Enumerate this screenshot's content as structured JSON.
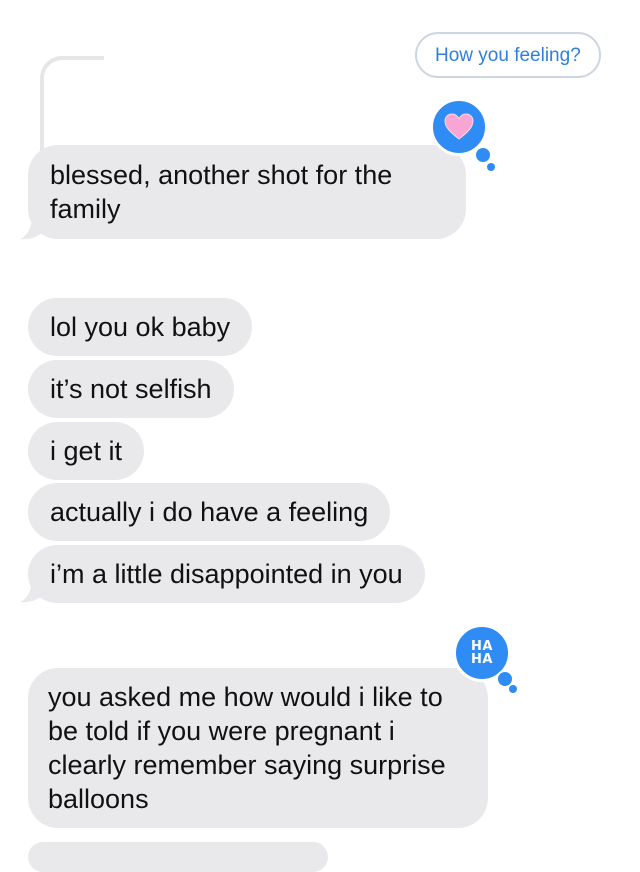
{
  "thread": {
    "quoted_reply": "How you feeling?",
    "messages": [
      {
        "text": "blessed, another shot for the family",
        "tapback": "heart"
      },
      {
        "text": "lol you ok baby"
      },
      {
        "text": "it’s not selfish"
      },
      {
        "text": "i get it"
      },
      {
        "text": "actually i do have a feeling"
      },
      {
        "text": "i’m a little disappointed in you"
      },
      {
        "text": "you asked me how would i like to be told if you were pregnant i clearly remember saying surprise balloons",
        "tapback": "haha"
      }
    ],
    "haha_line1": "HA",
    "haha_line2": "HA"
  },
  "colors": {
    "incoming_bubble": "#e9e9eb",
    "tapback_blue": "#2f8cf4",
    "quoted_text": "#2f7fe0",
    "heart": "#f7a6d3"
  }
}
